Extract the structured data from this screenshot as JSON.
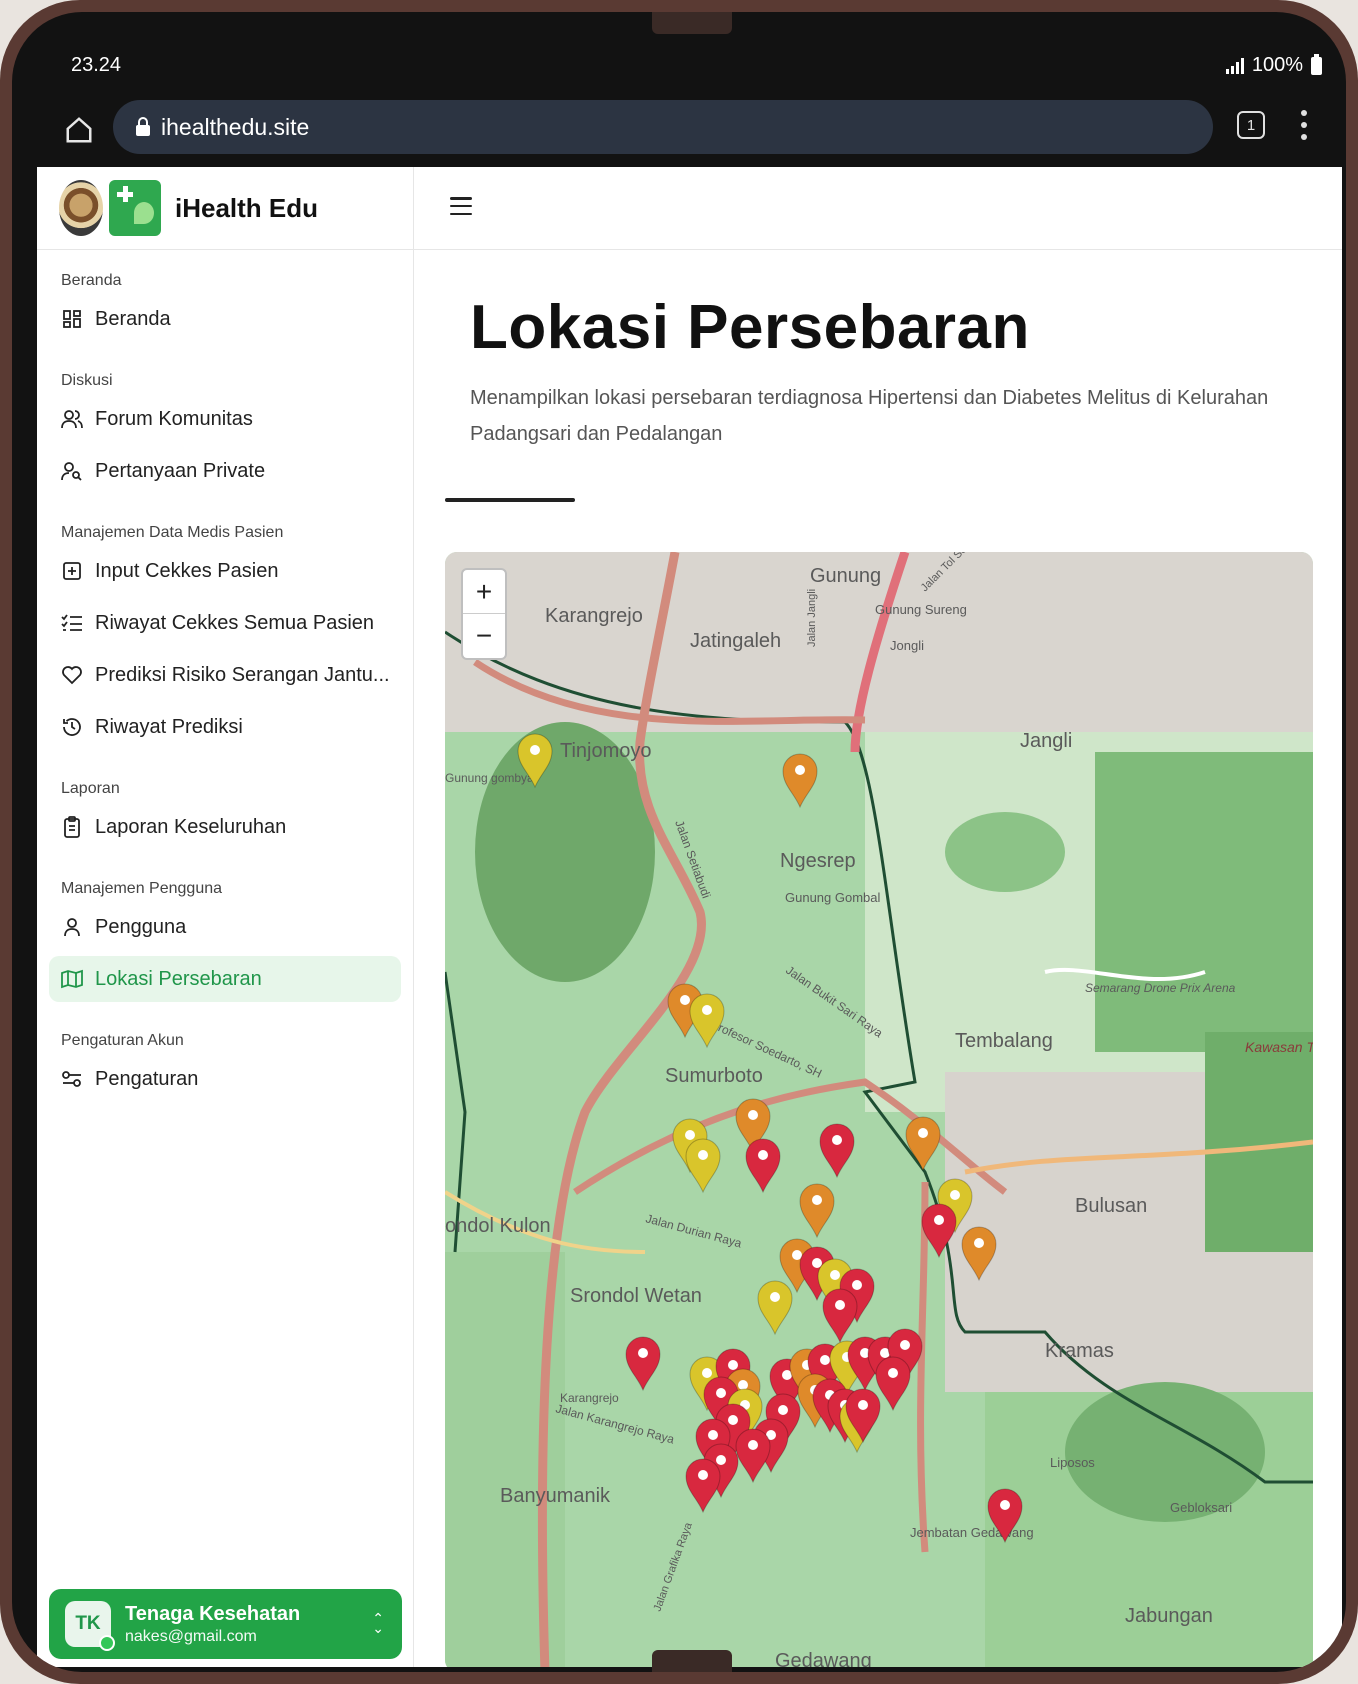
{
  "status_bar": {
    "time": "23.24",
    "battery": "100%"
  },
  "browser": {
    "url": "ihealthedu.site",
    "tab_count": "1"
  },
  "brand": {
    "name": "iHealth Edu"
  },
  "sidebar": {
    "sections": [
      {
        "title": "Beranda",
        "items": [
          {
            "label": "Beranda",
            "icon": "dashboard-icon"
          }
        ]
      },
      {
        "title": "Diskusi",
        "items": [
          {
            "label": "Forum Komunitas",
            "icon": "users-icon"
          },
          {
            "label": "Pertanyaan Private",
            "icon": "user-search-icon"
          }
        ]
      },
      {
        "title": "Manajemen Data Medis Pasien",
        "items": [
          {
            "label": "Input Cekkes Pasien",
            "icon": "plus-square-icon"
          },
          {
            "label": "Riwayat Cekkes Semua Pasien",
            "icon": "list-check-icon"
          },
          {
            "label": "Prediksi Risiko Serangan Jantu...",
            "icon": "heart-icon"
          },
          {
            "label": "Riwayat Prediksi",
            "icon": "history-icon"
          }
        ]
      },
      {
        "title": "Laporan",
        "items": [
          {
            "label": "Laporan Keseluruhan",
            "icon": "clipboard-icon"
          }
        ]
      },
      {
        "title": "Manajemen Pengguna",
        "items": [
          {
            "label": "Pengguna",
            "icon": "user-icon"
          },
          {
            "label": "Lokasi Persebaran",
            "icon": "map-icon",
            "active": true
          }
        ]
      },
      {
        "title": "Pengaturan Akun",
        "items": [
          {
            "label": "Pengaturan",
            "icon": "sliders-icon"
          }
        ]
      }
    ]
  },
  "user": {
    "initials": "TK",
    "name": "Tenaga Kesehatan",
    "email": "nakes@gmail.com"
  },
  "main": {
    "title": "Lokasi Persebaran",
    "description": "Menampilkan lokasi persebaran terdiagnosa Hipertensi dan Diabetes Melitus di Kelurahan Padangsari dan Pedalangan"
  },
  "map": {
    "zoom_in": "+",
    "zoom_out": "−",
    "labels": [
      "Karangrejo",
      "Gunung",
      "Jatingaleh",
      "Gunung Sureng",
      "Jongli",
      "Jangli",
      "Tinjomoyo",
      "Gunung gombyar",
      "Ngesrep",
      "Gunung Gombal",
      "Semarang Drone Prix Arena",
      "Tembalang",
      "Kawasan TNI AD",
      "Sumurboto",
      "Bulusan",
      "ondol Kulon",
      "Srondol Wetan",
      "Kramas",
      "Banyumanik",
      "Liposos",
      "Gebloksari",
      "Jembatan Gedawang",
      "Jabungan",
      "Gedawang",
      "Jalan Setiabudi",
      "Jalan Bukit Sari Raya",
      "Profesor Soedarto, SH",
      "Jalan Durian Raya",
      "Jalan Karangrejo Raya",
      "Jalan Jangli",
      "Jalan Tol Semarang",
      "Karangrejo",
      "Jalan Grafika Raya"
    ],
    "marker_colors": {
      "red": "#d8283f",
      "orange": "#df8a2a",
      "yellow": "#d9c52b"
    }
  }
}
